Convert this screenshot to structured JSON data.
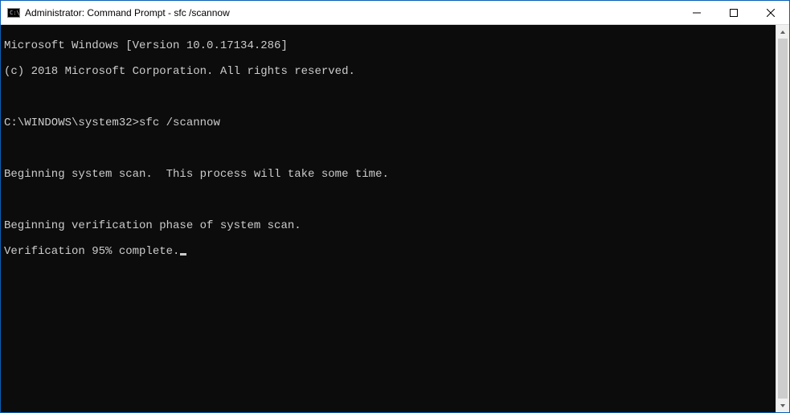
{
  "window": {
    "title": "Administrator: Command Prompt - sfc  /scannow"
  },
  "console": {
    "version_line": "Microsoft Windows [Version 10.0.17134.286]",
    "copyright_line": "(c) 2018 Microsoft Corporation. All rights reserved.",
    "prompt_path": "C:\\WINDOWS\\system32>",
    "command": "sfc /scannow",
    "msg_begin_scan": "Beginning system scan.  This process will take some time.",
    "msg_begin_verify": "Beginning verification phase of system scan.",
    "msg_progress": "Verification 95% complete."
  }
}
